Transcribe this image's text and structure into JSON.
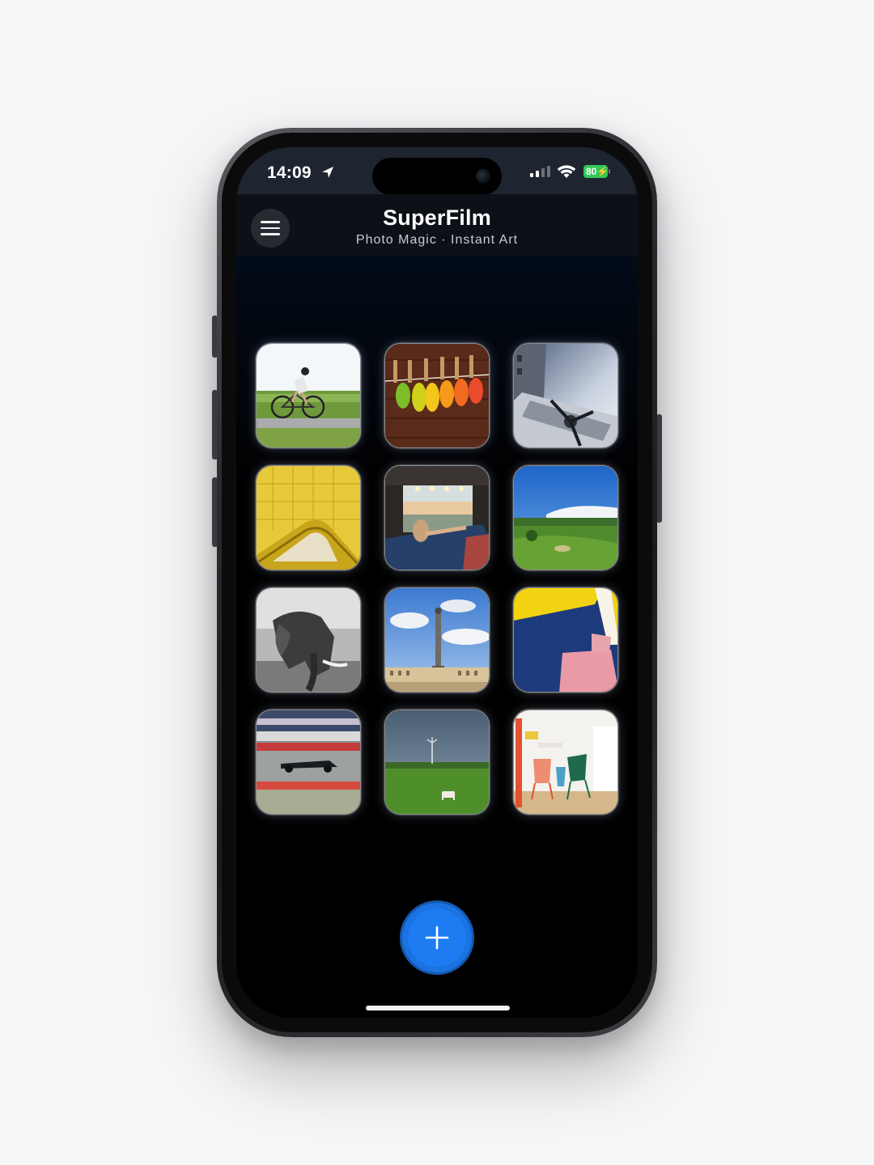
{
  "status_bar": {
    "time": "14:09",
    "battery": "80",
    "battery_color": "#34c759"
  },
  "header": {
    "title": "SuperFilm",
    "subtitle": "Photo Magic · Instant Art",
    "menu_icon": "hamburger-menu-icon"
  },
  "photos": [
    {
      "subject": "cyclist-on-road"
    },
    {
      "subject": "colorful-leaves-on-clothesline"
    },
    {
      "subject": "airplane-propeller"
    },
    {
      "subject": "yellow-tiled-wall"
    },
    {
      "subject": "woman-relaxing-in-van"
    },
    {
      "subject": "green-golf-landscape"
    },
    {
      "subject": "black-and-white-elephant"
    },
    {
      "subject": "column-monument-square"
    },
    {
      "subject": "abstract-blue-yellow-pink-wall"
    },
    {
      "subject": "race-car-on-track"
    },
    {
      "subject": "cow-in-green-field"
    },
    {
      "subject": "colorful-chairs-interior"
    }
  ],
  "add_button": {
    "icon": "plus-icon",
    "color": "#1d7cf2"
  }
}
